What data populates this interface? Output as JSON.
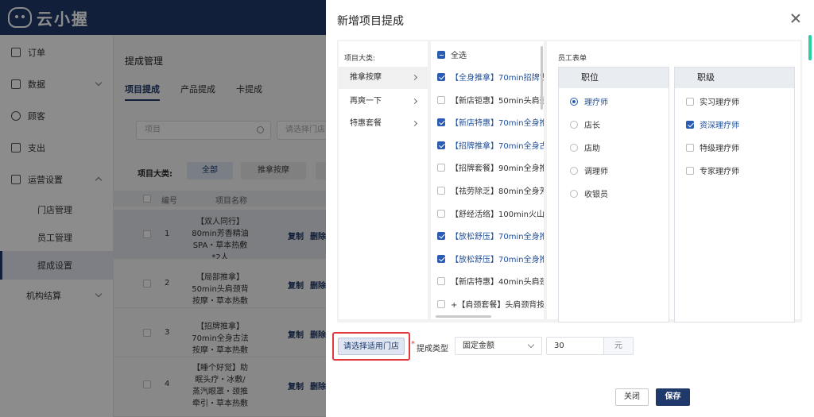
{
  "app": {
    "logo_text": "云小握"
  },
  "sidebar": {
    "items": [
      {
        "label": "订单"
      },
      {
        "label": "数据"
      },
      {
        "label": "顾客"
      },
      {
        "label": "支出"
      },
      {
        "label": "运营设置"
      },
      {
        "label": "机构结算"
      }
    ],
    "sub_items": [
      {
        "label": "门店管理"
      },
      {
        "label": "员工管理"
      },
      {
        "label": "提成设置"
      }
    ]
  },
  "page": {
    "title": "提成管理",
    "tabs": [
      {
        "label": "项目提成"
      },
      {
        "label": "产品提成"
      },
      {
        "label": "卡提成"
      }
    ],
    "search_placeholder": "项目",
    "store_placeholder": "请选择门店",
    "category_label": "项目大类:",
    "category_buttons": [
      {
        "label": "全部"
      },
      {
        "label": "推拿按摩"
      }
    ],
    "table_headers": {
      "num": "编号",
      "name": "项目名称"
    },
    "rows": [
      {
        "num": "1",
        "name": "【双人同行】80min芳香精油SPA・草本热敷*2人",
        "copy": "复制",
        "del": "删除"
      },
      {
        "num": "2",
        "name": "【局部推拿】50min头肩颈背按摩・草本热敷",
        "copy": "复制",
        "del": "删除"
      },
      {
        "num": "3",
        "name": "【招牌推拿】70min全身古法按摩・草本热敷",
        "copy": "复制",
        "del": "删除"
      },
      {
        "num": "4",
        "name": "【睡个好觉】助眠头疗・冰敷/蒸汽眼罩・颈推牵引・草本热敷",
        "copy": "复制",
        "del": "删除"
      }
    ]
  },
  "drawer": {
    "title": "新增项目提成",
    "category_title": "项目大类:",
    "categories": [
      {
        "label": "推拿按摩"
      },
      {
        "label": "再爽一下"
      },
      {
        "label": "特惠套餐"
      }
    ],
    "select_all": "全选",
    "projects": [
      {
        "label": "【全身推拿】70min招牌古",
        "checked": true
      },
      {
        "label": "【新店钜惠】50min头肩颈",
        "checked": false
      },
      {
        "label": "【新店特惠】70min全身推",
        "checked": true
      },
      {
        "label": "【招牌推拿】70min全身古",
        "checked": true
      },
      {
        "label": "【招牌套餐】90min全身推",
        "checked": false
      },
      {
        "label": "【祛劳除乏】80min全身芳",
        "checked": false
      },
      {
        "label": "【舒经活络】100min火山",
        "checked": false
      },
      {
        "label": "【放松舒压】70min全身推",
        "checked": true
      },
      {
        "label": "【放松舒压】70min全身推",
        "checked": true
      },
      {
        "label": "【新店特惠】40min头肩颈",
        "checked": false
      },
      {
        "label": "+【肩颈套餐】头肩颈背按",
        "checked": false
      }
    ],
    "staff_title": "员工表单",
    "position_header": "职位",
    "positions": [
      {
        "label": "理疗师",
        "selected": true
      },
      {
        "label": "店长",
        "selected": false
      },
      {
        "label": "店助",
        "selected": false
      },
      {
        "label": "调理师",
        "selected": false
      },
      {
        "label": "收银员",
        "selected": false
      }
    ],
    "level_header": "职级",
    "levels": [
      {
        "label": "实习理疗师",
        "checked": false
      },
      {
        "label": "资深理疗师",
        "checked": true
      },
      {
        "label": "特级理疗师",
        "checked": false
      },
      {
        "label": "专家理疗师",
        "checked": false
      }
    ],
    "store_button": "请选择适用门店",
    "required_mark": "*",
    "commission_type_label": "提成类型",
    "commission_type_value": "固定金额",
    "amount_value": "30",
    "amount_unit": "元",
    "close_button": "关闭",
    "save_button": "保存"
  },
  "colors": {
    "brand": "#1f3a6a",
    "accent_check": "#2a5bb5",
    "highlight_border": "#e23a3a",
    "scroll_accent": "#2bd1a4"
  }
}
